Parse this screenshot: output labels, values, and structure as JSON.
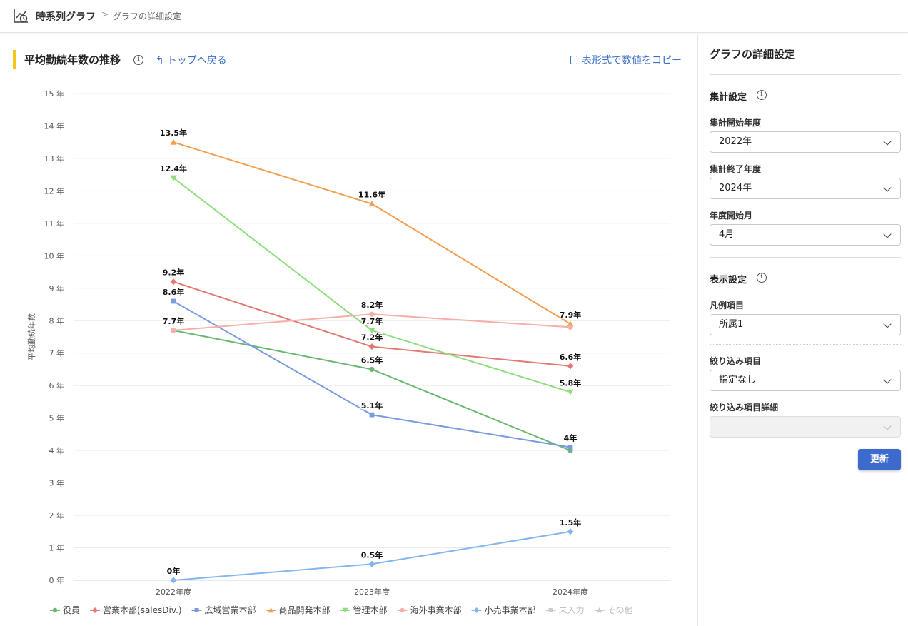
{
  "header": {
    "app_title": "時系列グラフ",
    "breadcrumb_sep": ">",
    "breadcrumb_current": "グラフの詳細設定"
  },
  "main": {
    "title": "平均勤続年数の推移",
    "back_label": "トップへ戻る",
    "copy_label": "表形式で数値をコピー"
  },
  "chart_data": {
    "type": "line",
    "ylabel": "平均勤続年数",
    "ylim": [
      0,
      15
    ],
    "y_tick_suffix": " 年",
    "value_suffix": "年",
    "categories": [
      "2022年度",
      "2023年度",
      "2024年度"
    ],
    "grid": true,
    "legend_position": "bottom",
    "series": [
      {
        "name": "役員",
        "color": "#6ab86f",
        "marker": "circle",
        "values": [
          7.7,
          6.5,
          4
        ]
      },
      {
        "name": "営業本部(salesDiv.)",
        "color": "#e07b74",
        "marker": "diamond",
        "values": [
          9.2,
          7.2,
          6.6
        ]
      },
      {
        "name": "広域営業本部",
        "color": "#7b9be0",
        "marker": "square",
        "values": [
          8.6,
          5.1,
          4.1
        ]
      },
      {
        "name": "商品開発本部",
        "color": "#f0a050",
        "marker": "triangle-up",
        "values": [
          13.5,
          11.6,
          7.9
        ]
      },
      {
        "name": "管理本部",
        "color": "#8ede80",
        "marker": "triangle-down",
        "values": [
          12.4,
          7.7,
          5.8
        ]
      },
      {
        "name": "海外事業本部",
        "color": "#f4b0a8",
        "marker": "circle",
        "values": [
          7.7,
          8.2,
          7.8
        ]
      },
      {
        "name": "小売事業本部",
        "color": "#85b5ee",
        "marker": "diamond",
        "values": [
          0,
          0.5,
          1.5
        ]
      },
      {
        "name": "未入力",
        "color": "#cccccc",
        "marker": "square",
        "values": [],
        "inactive": true
      },
      {
        "name": "その他",
        "color": "#cccccc",
        "marker": "triangle-up",
        "values": [],
        "inactive": true
      }
    ],
    "data_labels": [
      {
        "series": 0,
        "index": 0,
        "text": "7.7年"
      },
      {
        "series": 0,
        "index": 1,
        "text": "6.5年"
      },
      {
        "series": 1,
        "index": 0,
        "text": "9.2年"
      },
      {
        "series": 1,
        "index": 1,
        "text": "7.2年"
      },
      {
        "series": 1,
        "index": 2,
        "text": "6.6年"
      },
      {
        "series": 2,
        "index": 0,
        "text": "8.6年"
      },
      {
        "series": 2,
        "index": 1,
        "text": "5.1年"
      },
      {
        "series": 2,
        "index": 2,
        "text": "4年"
      },
      {
        "series": 3,
        "index": 0,
        "text": "13.5年"
      },
      {
        "series": 3,
        "index": 1,
        "text": "11.6年"
      },
      {
        "series": 3,
        "index": 2,
        "text": "7.9年"
      },
      {
        "series": 4,
        "index": 0,
        "text": "12.4年"
      },
      {
        "series": 4,
        "index": 1,
        "text": "7.7年"
      },
      {
        "series": 4,
        "index": 2,
        "text": "5.8年"
      },
      {
        "series": 5,
        "index": 1,
        "text": "8.2年"
      },
      {
        "series": 6,
        "index": 0,
        "text": "0年"
      },
      {
        "series": 6,
        "index": 1,
        "text": "0.5年"
      },
      {
        "series": 6,
        "index": 2,
        "text": "1.5年"
      }
    ]
  },
  "panel": {
    "title": "グラフの詳細設定",
    "aggregate": {
      "title": "集計設定",
      "start_label": "集計開始年度",
      "start_value": "2022年",
      "end_label": "集計終了年度",
      "end_value": "2024年",
      "month_label": "年度開始月",
      "month_value": "4月"
    },
    "display": {
      "title": "表示設定",
      "legend_label": "凡例項目",
      "legend_value": "所属1",
      "filter_label": "絞り込み項目",
      "filter_value": "指定なし",
      "filter_detail_label": "絞り込み項目詳細",
      "filter_detail_value": ""
    },
    "update_label": "更新"
  }
}
